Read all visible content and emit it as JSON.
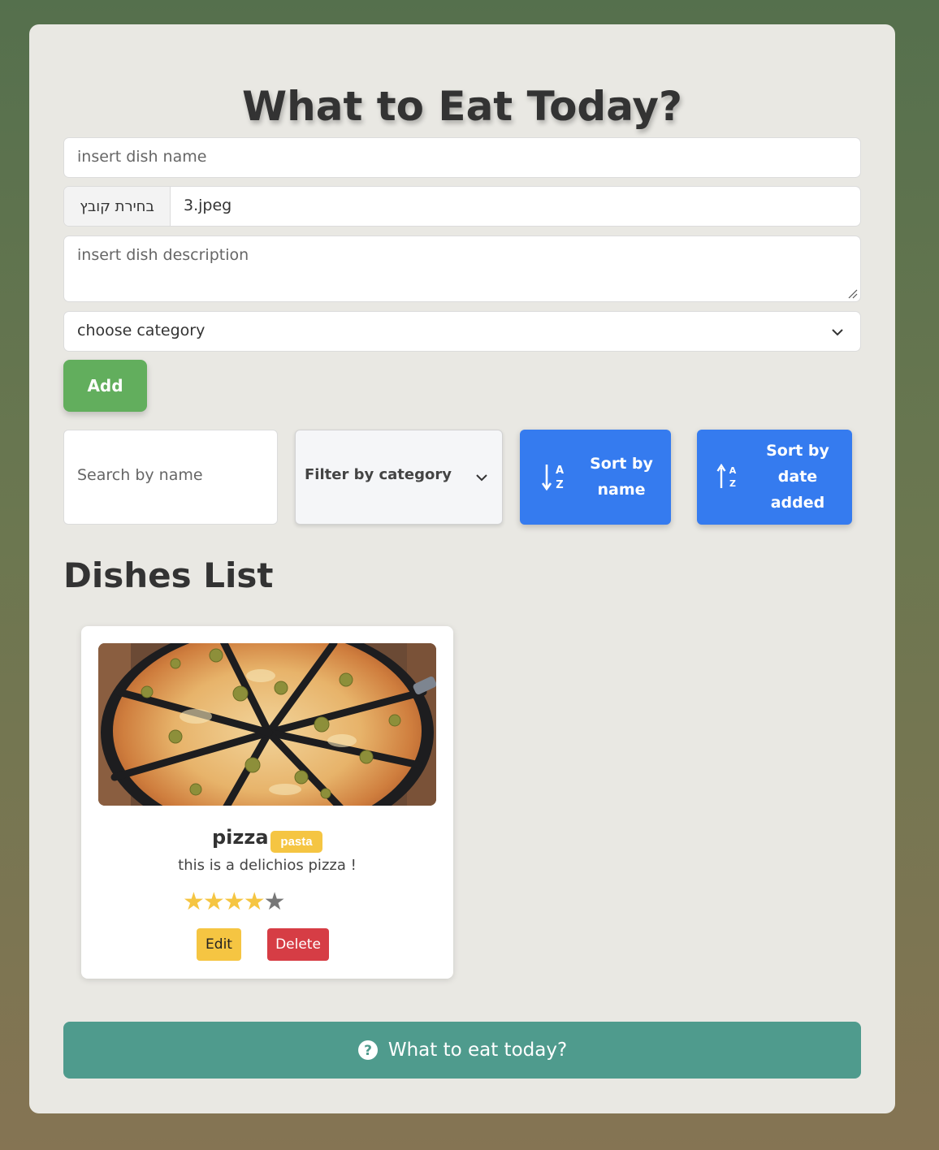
{
  "title": "What to Eat Today?",
  "form": {
    "name_placeholder": "insert dish name",
    "file_button": "בחירת קובץ",
    "file_name": "3.jpeg",
    "description_placeholder": "insert dish description",
    "category_selected": "choose category",
    "add_label": "Add"
  },
  "controls": {
    "search_placeholder": "Search by name",
    "filter_label": "Filter by category",
    "sort_name_label": "Sort by name",
    "sort_date_label": "Sort by date added"
  },
  "list_title": "Dishes List",
  "dishes": [
    {
      "name": "pizza",
      "category": "pasta",
      "description": "this is a delichios pizza !",
      "rating": 4,
      "rating_max": 5,
      "edit_label": "Edit",
      "delete_label": "Delete"
    }
  ],
  "suggest_label": "What to eat today?",
  "colors": {
    "add": "#62ae5d",
    "sort": "#357bef",
    "badge": "#f5c542",
    "edit": "#f5c542",
    "delete": "#d63d45",
    "suggest": "#4f9b8d"
  },
  "icons": [
    "sort-alpha-down-icon",
    "sort-alpha-up-icon",
    "question-circle-icon",
    "chevron-down-icon"
  ]
}
